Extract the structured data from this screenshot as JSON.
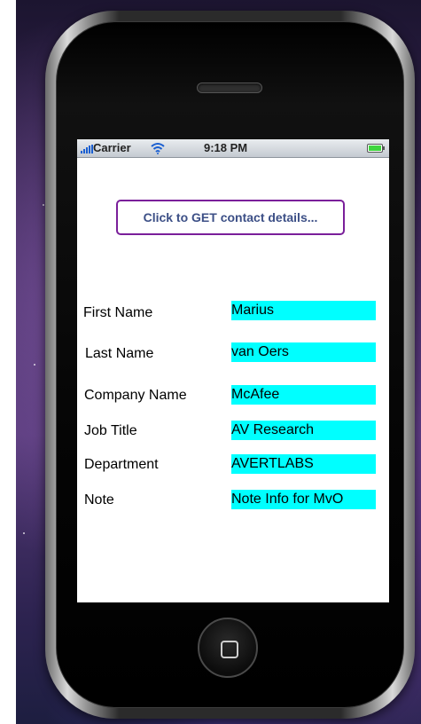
{
  "status_bar": {
    "carrier": "Carrier",
    "time": "9:18 PM",
    "signal_icon": "signal-bars-icon",
    "wifi_icon": "wifi-icon",
    "battery_icon": "battery-icon"
  },
  "get_button": {
    "label": "Click to GET contact details..."
  },
  "fields": [
    {
      "label": "First Name",
      "value": "Marius"
    },
    {
      "label": "Last Name",
      "value": "van Oers"
    },
    {
      "label": "Company Name",
      "value": "McAfee"
    },
    {
      "label": "Job Title",
      "value": "AV Research"
    },
    {
      "label": "Department",
      "value": "AVERTLABS"
    },
    {
      "label": "Note",
      "value": "Note Info for MvO"
    }
  ],
  "colors": {
    "value_highlight": "#00ffff",
    "button_border": "#7a1f9a",
    "button_text": "#3c4f86",
    "battery_fill": "#3fd63f"
  }
}
